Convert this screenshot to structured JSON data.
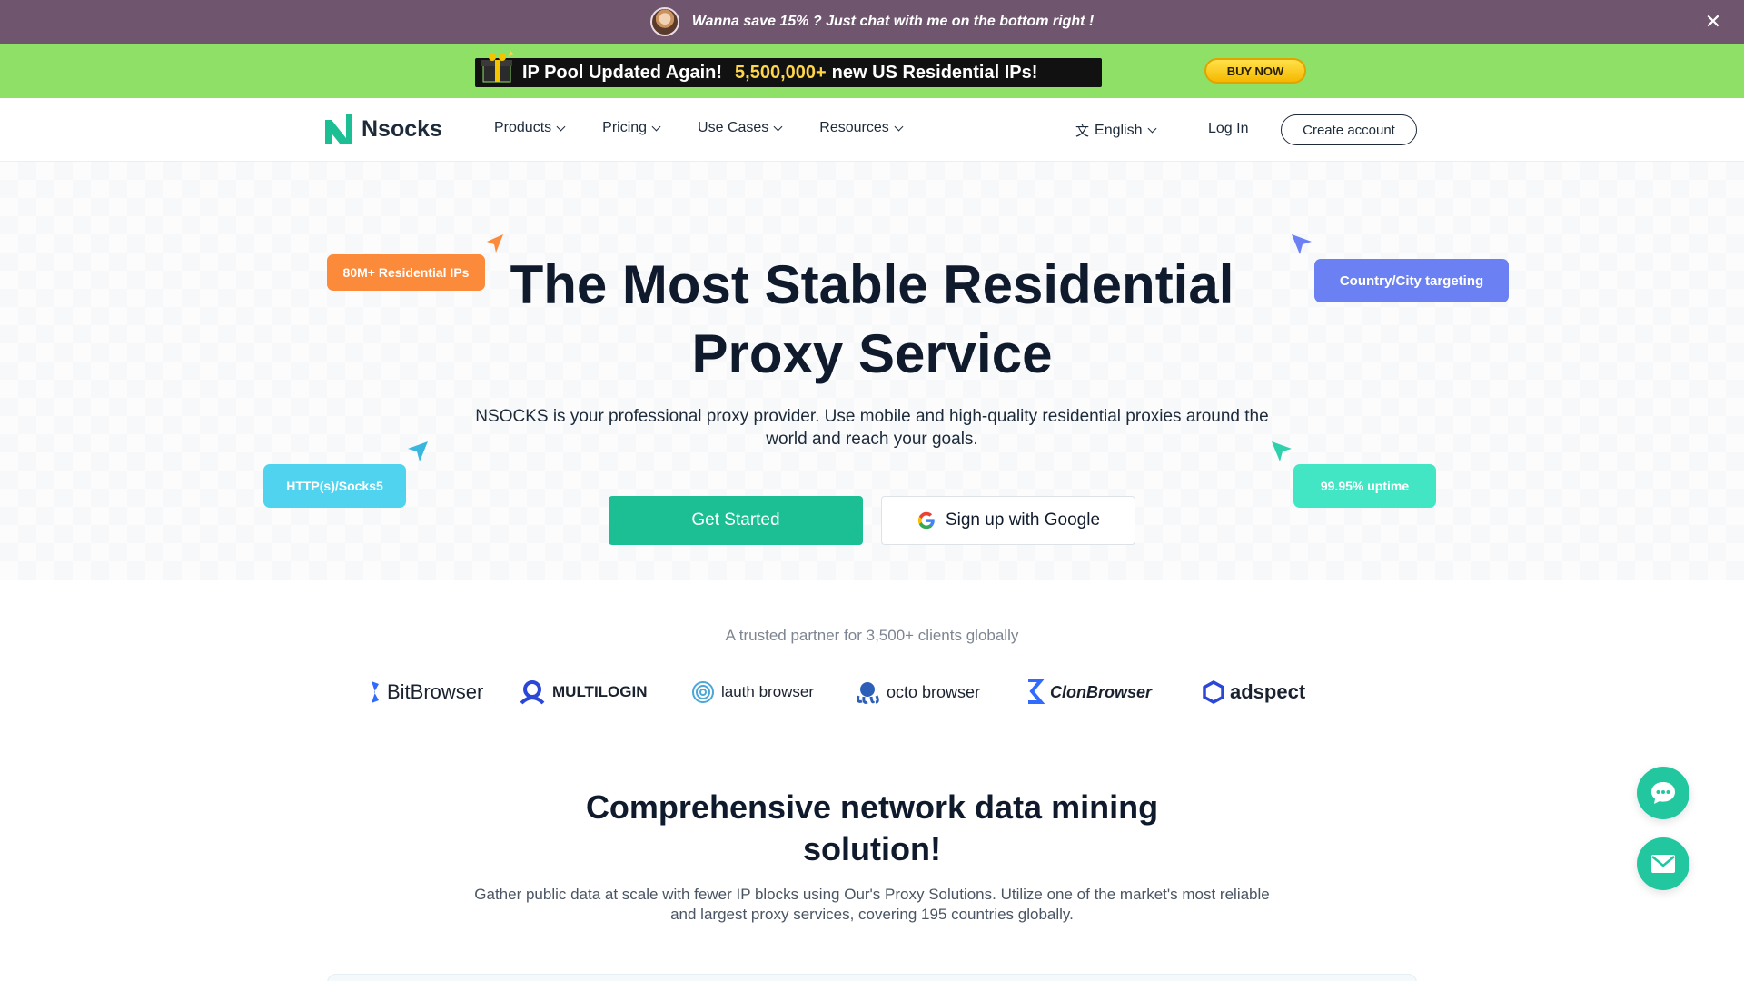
{
  "promo": {
    "text": "Wanna save 15% ? Just chat with me on the bottom right !",
    "close_icon": "close-icon"
  },
  "ad_banner": {
    "prefix": "IP Pool Updated Again!",
    "highlight": "5,500,000+",
    "suffix": "new US Residential IPs!",
    "buy_label": "BUY NOW"
  },
  "nav": {
    "logo_text": "Nsocks",
    "items": [
      {
        "label": "Products"
      },
      {
        "label": "Pricing"
      },
      {
        "label": "Use Cases"
      },
      {
        "label": "Resources"
      }
    ],
    "language": "English",
    "login": "Log In",
    "create_account": "Create account"
  },
  "hero": {
    "title_line1": "The Most Stable Residential",
    "title_line2": "Proxy Service",
    "subtitle": "NSOCKS is your professional proxy provider. Use mobile and high-quality residential proxies around the world and reach your goals.",
    "primary_cta": "Get Started",
    "google_cta": "Sign up with Google",
    "tags": {
      "ips": "80M+ Residential IPs",
      "targeting": "Country/City targeting",
      "protocols": "HTTP(s)/Socks5",
      "uptime": "99.95% uptime"
    }
  },
  "trusted": {
    "text": "A trusted partner for 3,500+ clients globally",
    "brands": [
      {
        "name": "BitBrowser"
      },
      {
        "name": "MULTILOGIN"
      },
      {
        "name": "lauth browser"
      },
      {
        "name": "octo browser"
      },
      {
        "name": "ClonBrowser"
      },
      {
        "name": "adspect"
      }
    ]
  },
  "section": {
    "title_line1": "Comprehensive network data mining",
    "title_line2": "solution!",
    "subtitle": "Gather public data at scale with fewer IP blocks using Our's Proxy Solutions. Utilize one of the market's most reliable and largest proxy services, covering 195 countries globally."
  },
  "colors": {
    "promo_bg": "#6f566e",
    "ad_bg": "#8fe067",
    "accent": "#1cbf93",
    "tag_orange": "#fb8a3a",
    "tag_blue": "#6b80f3",
    "tag_cyan": "#4fd3ef",
    "tag_mint": "#43e6c4"
  }
}
